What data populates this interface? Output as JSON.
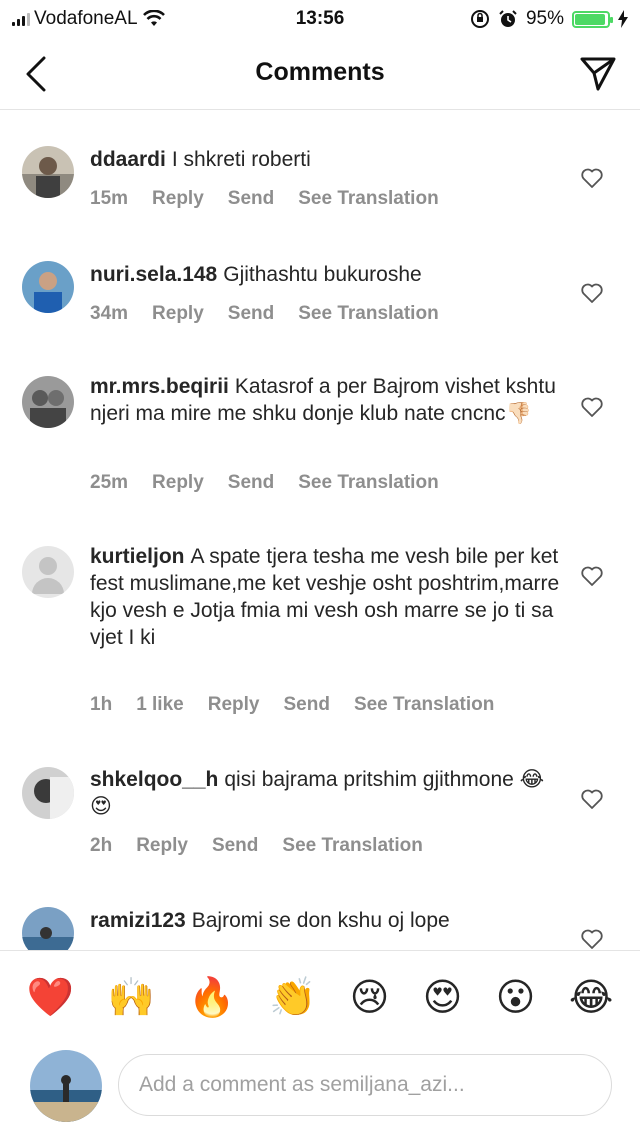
{
  "status_bar": {
    "carrier": "VodafoneAL",
    "time": "13:56",
    "battery": "95%"
  },
  "header": {
    "title": "Comments"
  },
  "comments": [
    {
      "username": "ddaardi",
      "text": "I shkreti roberti",
      "time": "15m",
      "likes": "",
      "reply": "Reply",
      "send": "Send",
      "translate": "See Translation"
    },
    {
      "username": "nuri.sela.148",
      "text": "Gjithashtu bukuroshe",
      "time": "34m",
      "likes": "",
      "reply": "Reply",
      "send": "Send",
      "translate": "See Translation"
    },
    {
      "username": "mr.mrs.beqirii",
      "text": "Katasrof a per  Bajrom vishet kshtu njeri ma mire me shku donje klub nate cncnc👎🏻",
      "time": "25m",
      "likes": "",
      "reply": "Reply",
      "send": "Send",
      "translate": "See Translation"
    },
    {
      "username": "kurtieljon",
      "text": "A spate tjera tesha me vesh bile per ket fest muslimane,me ket veshje osht poshtrim,marre kjo vesh e Jotja fmia mi vesh osh marre se jo ti sa vjet I ki",
      "time": "1h",
      "likes": "1 like",
      "reply": "Reply",
      "send": "Send",
      "translate": "See Translation"
    },
    {
      "username": "shkelqoo__h",
      "text": "qisi bajrama pritshim gjithmone 😂😍",
      "time": "2h",
      "likes": "",
      "reply": "Reply",
      "send": "Send",
      "translate": "See Translation"
    },
    {
      "username": "ramizi123",
      "text": "Bajromi se don kshu oj lope",
      "time": "",
      "likes": "",
      "reply": "",
      "send": "",
      "translate": ""
    }
  ],
  "emoji_bar": [
    "❤️",
    "🙌",
    "🔥",
    "👏",
    "😢",
    "😍",
    "😮",
    "😂"
  ],
  "compose": {
    "placeholder": "Add a comment as semiljana_azi..."
  },
  "colors": {
    "meta_text": "#8e8e8e",
    "border": "#e4e4e4",
    "battery": "#4cd964"
  }
}
